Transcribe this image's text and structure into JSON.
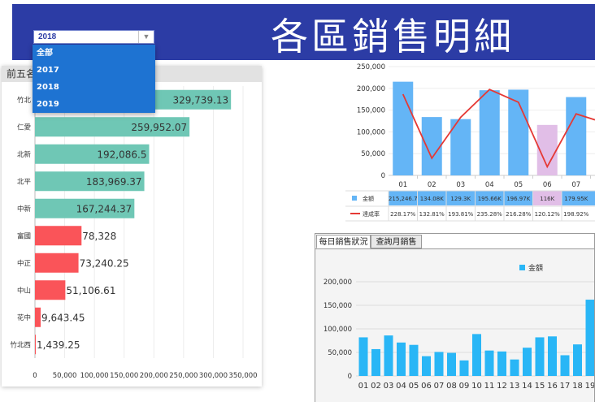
{
  "banner": {
    "title": "各區銷售明細"
  },
  "year_select": {
    "value": "2018",
    "options": [
      "全部",
      "2017",
      "2018",
      "2019"
    ]
  },
  "ranking_panel": {
    "title": "前五名"
  },
  "daily_panel": {
    "tabs": [
      "每日銷售狀況",
      "查詢月銷售"
    ]
  },
  "colors": {
    "banner": "#2c3ca5",
    "teal": "#6fc7b5",
    "red": "#fa5459",
    "blue": "#64b5f6",
    "purple": "#e1bee7",
    "line": "#e53935",
    "daily": "#29b6f6"
  },
  "chart_data": [
    {
      "type": "bar",
      "orientation": "horizontal",
      "categories": [
        "竹北",
        "仁愛",
        "北新",
        "北平",
        "中新",
        "富國",
        "中正",
        "中山",
        "花中",
        "竹北西"
      ],
      "values": [
        329739.13,
        259952.07,
        192086.5,
        183969.37,
        167244.37,
        78328,
        73240.25,
        51106.61,
        9643.45,
        1439.25
      ],
      "value_labels": [
        "329,739.13",
        "259,952.07",
        "192,086.5",
        "183,969.37",
        "167,244.37",
        "78,328",
        "73,240.25",
        "51,106.61",
        "9,643.45",
        "1,439.25"
      ],
      "bar_colors": [
        "#6fc7b5",
        "#6fc7b5",
        "#6fc7b5",
        "#6fc7b5",
        "#6fc7b5",
        "#fa5459",
        "#fa5459",
        "#fa5459",
        "#fa5459",
        "#fa5459"
      ],
      "xlim": [
        0,
        350000
      ],
      "xticks": [
        "0",
        "50,000",
        "100,000",
        "150,000",
        "200,000",
        "250,000",
        "300,000",
        "350,000"
      ],
      "grid": true
    },
    {
      "type": "bar",
      "categories": [
        "01",
        "02",
        "03",
        "04",
        "05",
        "06",
        "07"
      ],
      "series": [
        {
          "name": "金額",
          "type": "bar",
          "values": [
            215246.7,
            134080,
            129300,
            195660,
            196970,
            116000,
            179950
          ],
          "labels": [
            "215,246.7",
            "134.08K",
            "129.3K",
            "195.66K",
            "196.97K",
            "116K",
            "179.95K"
          ]
        },
        {
          "name": "達成率",
          "type": "line",
          "values": [
            228.17,
            132.81,
            193.81,
            235.28,
            216.28,
            120.12,
            198.92
          ],
          "labels": [
            "228.17%",
            "132.81%",
            "193.81%",
            "235.28%",
            "216.28%",
            "120.12%",
            "198.92%"
          ]
        }
      ],
      "highlight_category": "06",
      "ylim": [
        0,
        250000
      ],
      "yticks": [
        "0",
        "50,000",
        "100,000",
        "150,000",
        "200,000",
        "250,000"
      ],
      "legend": "table-bottom"
    },
    {
      "type": "bar",
      "categories": [
        "01",
        "02",
        "03",
        "04",
        "05",
        "06",
        "07",
        "08",
        "09",
        "10",
        "11",
        "12",
        "13",
        "14",
        "15",
        "16",
        "17",
        "18",
        "19"
      ],
      "series": [
        {
          "name": "金額",
          "values": [
            82000,
            57000,
            86000,
            71000,
            66000,
            42000,
            51000,
            49000,
            33000,
            89000,
            54000,
            52000,
            35000,
            60000,
            82000,
            84000,
            44000,
            67000,
            162000
          ]
        }
      ],
      "ylim": [
        0,
        200000
      ],
      "yticks": [
        "0",
        "50,000",
        "100,000",
        "150,000",
        "200,000"
      ],
      "legend": "top-right",
      "grid": true
    }
  ]
}
